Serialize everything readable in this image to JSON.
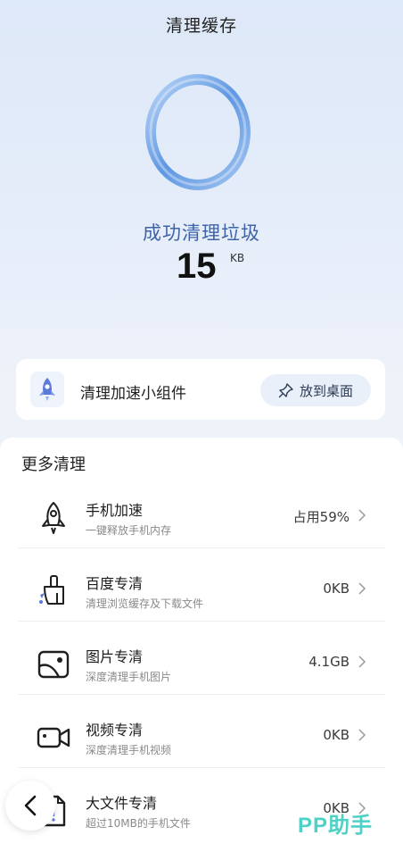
{
  "header": {
    "title": "清理缓存"
  },
  "result": {
    "message": "成功清理垃圾",
    "size_value": "15",
    "size_unit": "KB"
  },
  "widget": {
    "label": "清理加速小组件",
    "pin_label": "放到桌面",
    "icon": "rocket-icon"
  },
  "more": {
    "title": "更多清理",
    "items": [
      {
        "title": "手机加速",
        "subtitle": "一键释放手机内存",
        "value": "占用59%",
        "icon": "rocket-icon"
      },
      {
        "title": "百度专清",
        "subtitle": "清理浏览缓存及下载文件",
        "value": "0KB",
        "icon": "broom-icon"
      },
      {
        "title": "图片专清",
        "subtitle": "深度清理手机图片",
        "value": "4.1GB",
        "icon": "image-icon"
      },
      {
        "title": "视频专清",
        "subtitle": "深度清理手机视频",
        "value": "0KB",
        "icon": "video-icon"
      },
      {
        "title": "大文件专清",
        "subtitle": "超过10MB的手机文件",
        "value": "0KB",
        "icon": "file-icon"
      }
    ]
  },
  "watermark": "PP助手",
  "colors": {
    "accent": "#3e63a6",
    "ring": "#6fa3e8",
    "watermark": "#4fd1c5"
  }
}
